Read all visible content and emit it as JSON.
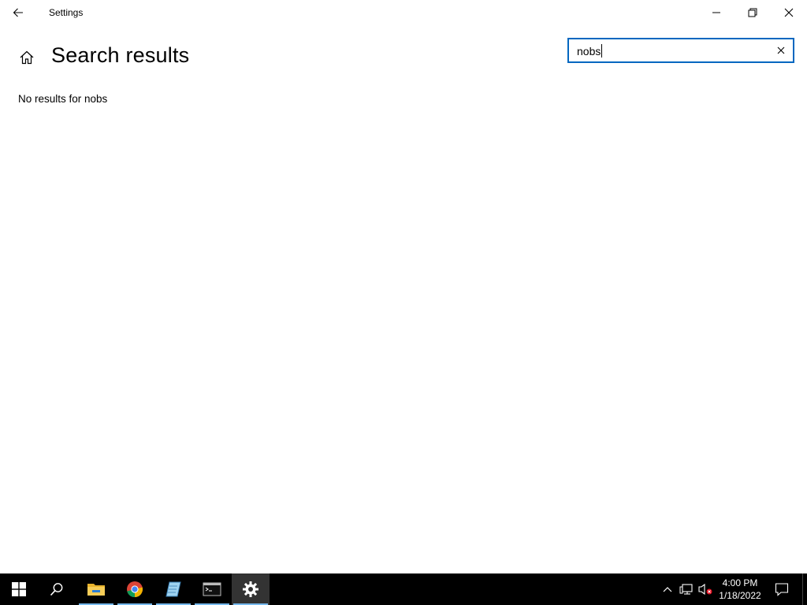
{
  "window": {
    "title": "Settings",
    "controls": {
      "minimize": "minimize-icon",
      "maximize": "restore-icon",
      "close": "close-icon"
    }
  },
  "header": {
    "title": "Search results",
    "home_icon": "home-icon",
    "back_icon": "back-arrow-icon"
  },
  "search": {
    "value": "nobs",
    "clear_icon": "clear-icon"
  },
  "results": {
    "message": "No results for nobs"
  },
  "taskbar": {
    "apps": [
      {
        "name": "start-icon"
      },
      {
        "name": "search-icon"
      },
      {
        "name": "file-explorer-icon"
      },
      {
        "name": "chrome-icon"
      },
      {
        "name": "notepad-icon"
      },
      {
        "name": "terminal-icon"
      },
      {
        "name": "settings-gear-icon"
      }
    ],
    "tray": {
      "clock_time": "4:00 PM",
      "clock_date": "1/18/2022"
    }
  },
  "colors": {
    "accent": "#0067c0",
    "taskbar_bg": "#000000",
    "running_indicator": "#76b9ed"
  }
}
